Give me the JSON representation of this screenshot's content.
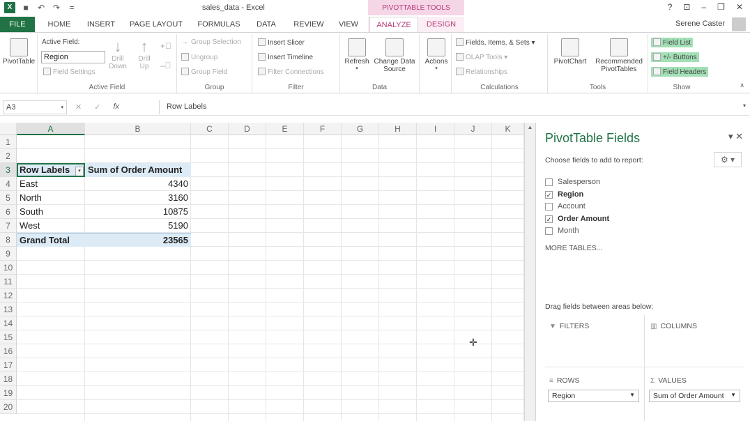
{
  "window": {
    "title": "sales_data - Excel",
    "context_header": "PIVOTTABLE TOOLS",
    "user": "Serene Caster",
    "help": "?",
    "minimize": "–",
    "restore": "❐",
    "close": "✕"
  },
  "tabs": [
    "FILE",
    "HOME",
    "INSERT",
    "PAGE LAYOUT",
    "FORMULAS",
    "DATA",
    "REVIEW",
    "VIEW",
    "ANALYZE",
    "DESIGN"
  ],
  "ribbon": {
    "pivottable": "PivotTable",
    "active_field_label": "Active Field:",
    "active_field_value": "Region",
    "field_settings": "Field Settings",
    "drill_down": "Drill\nDown",
    "drill_up": "Drill\nUp",
    "active_field_group": "Active Field",
    "group_selection": "Group Selection",
    "ungroup": "Ungroup",
    "group_field": "Group Field",
    "group_group": "Group",
    "insert_slicer": "Insert Slicer",
    "insert_timeline": "Insert Timeline",
    "filter_connections": "Filter Connections",
    "filter_group": "Filter",
    "refresh": "Refresh",
    "change_data_source": "Change Data\nSource",
    "data_group": "Data",
    "actions": "Actions",
    "fields_items_sets": "Fields, Items, & Sets",
    "olap_tools": "OLAP Tools",
    "relationships": "Relationships",
    "calculations_group": "Calculations",
    "pivotchart": "PivotChart",
    "recommended_pivottables": "Recommended\nPivotTables",
    "tools_group": "Tools",
    "field_list": "Field List",
    "plus_minus_buttons": "+/- Buttons",
    "field_headers": "Field Headers",
    "show_group": "Show"
  },
  "formula_bar": {
    "name_box": "A3",
    "fx": "fx",
    "content": "Row Labels"
  },
  "grid": {
    "columns": [
      "A",
      "B",
      "C",
      "D",
      "E",
      "F",
      "G",
      "H",
      "I",
      "J",
      "K"
    ],
    "rows": [
      "1",
      "2",
      "3",
      "4",
      "5",
      "6",
      "7",
      "8",
      "9",
      "10",
      "11",
      "12",
      "13",
      "14",
      "15",
      "16",
      "17",
      "18",
      "19",
      "20"
    ],
    "pivot": {
      "header_labels": "Row Labels",
      "header_values": "Sum of Order Amount",
      "rows": [
        {
          "label": "East",
          "value": "4340"
        },
        {
          "label": "North",
          "value": "3160"
        },
        {
          "label": "South",
          "value": "10875"
        },
        {
          "label": "West",
          "value": "5190"
        }
      ],
      "total_label": "Grand Total",
      "total_value": "23565"
    }
  },
  "pane": {
    "title": "PivotTable Fields",
    "subtitle": "Choose fields to add to report:",
    "fields": [
      {
        "name": "Salesperson",
        "checked": false
      },
      {
        "name": "Region",
        "checked": true
      },
      {
        "name": "Account",
        "checked": false
      },
      {
        "name": "Order Amount",
        "checked": true
      },
      {
        "name": "Month",
        "checked": false
      }
    ],
    "more_tables": "MORE TABLES...",
    "drag_label": "Drag fields between areas below:",
    "filters": "FILTERS",
    "columns": "COLUMNS",
    "rows": "ROWS",
    "values": "VALUES",
    "rows_item": "Region",
    "values_item": "Sum of Order Amount"
  },
  "colors": {
    "excel_green": "#217346",
    "context_pink": "#b83b7a",
    "pivot_header_fill": "#ddebf7",
    "show_highlight": "#a3e0b6"
  }
}
